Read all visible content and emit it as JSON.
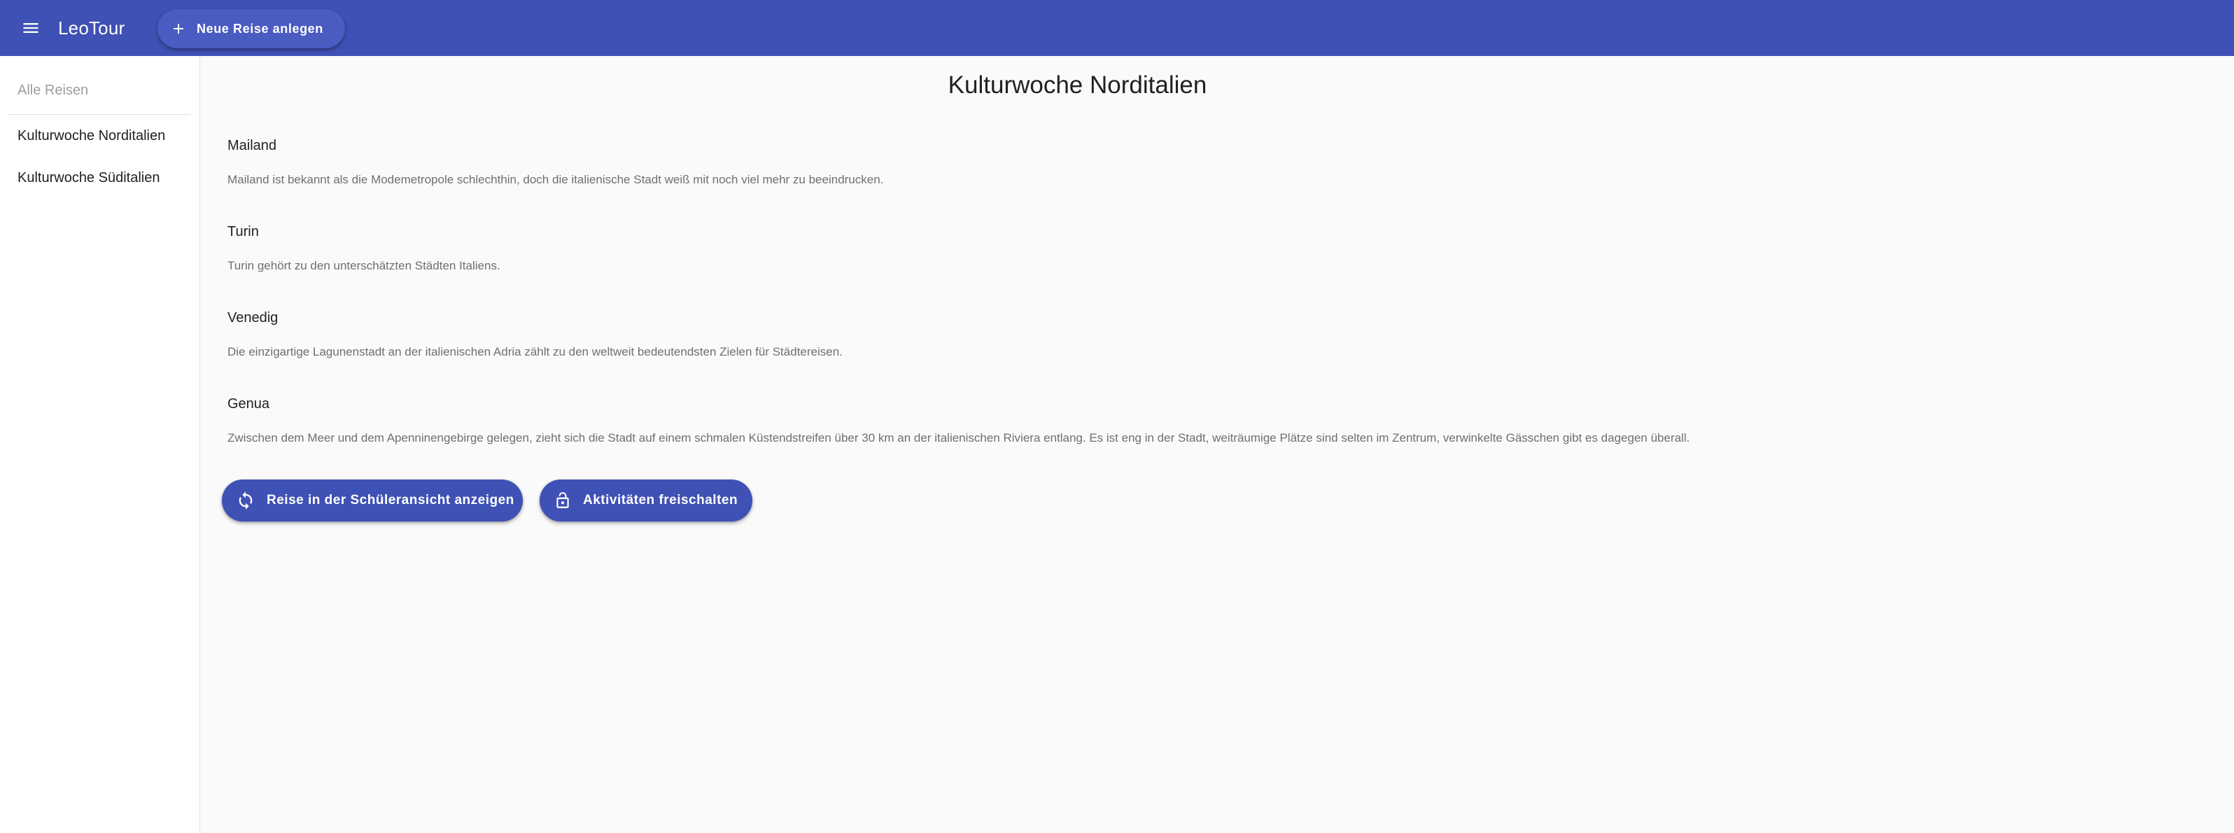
{
  "header": {
    "menu_icon": "menu-icon",
    "app_title": "LeoTour",
    "new_trip_button": {
      "icon": "add-icon",
      "label": "Neue Reise anlegen"
    }
  },
  "sidebar": {
    "header": "Alle Reisen",
    "items": [
      {
        "label": "Kulturwoche Norditalien"
      },
      {
        "label": "Kulturwoche Süditalien"
      }
    ]
  },
  "main": {
    "title": "Kulturwoche Norditalien",
    "cities": [
      {
        "name": "Mailand",
        "description": "Mailand ist bekannt als die Modemetropole schlechthin, doch die italienische Stadt weiß mit noch viel mehr zu beeindrucken."
      },
      {
        "name": "Turin",
        "description": "Turin gehört zu den unterschätzten Städten Italiens."
      },
      {
        "name": "Venedig",
        "description": "Die einzigartige Lagunenstadt an der italienischen Adria zählt zu den weltweit bedeutendsten Zielen für Städtereisen."
      },
      {
        "name": "Genua",
        "description": "Zwischen dem Meer und dem Apenninengebirge gelegen, zieht sich die Stadt auf einem schmalen Küstendstreifen über 30 km an der italienischen Riviera entlang. Es ist eng in der Stadt, weiträumige Plätze sind selten im Zentrum, verwinkelte Gässchen gibt es dagegen überall."
      }
    ],
    "actions": {
      "student_view": {
        "icon": "sync-icon",
        "label": "Reise in der Schüleransicht anzeigen"
      },
      "unlock_activities": {
        "icon": "lock-open-icon",
        "label": "Aktivitäten freischalten"
      }
    }
  },
  "colors": {
    "primary": "#3f51b5",
    "background": "#fafafa",
    "sidebar": "#ffffff"
  }
}
